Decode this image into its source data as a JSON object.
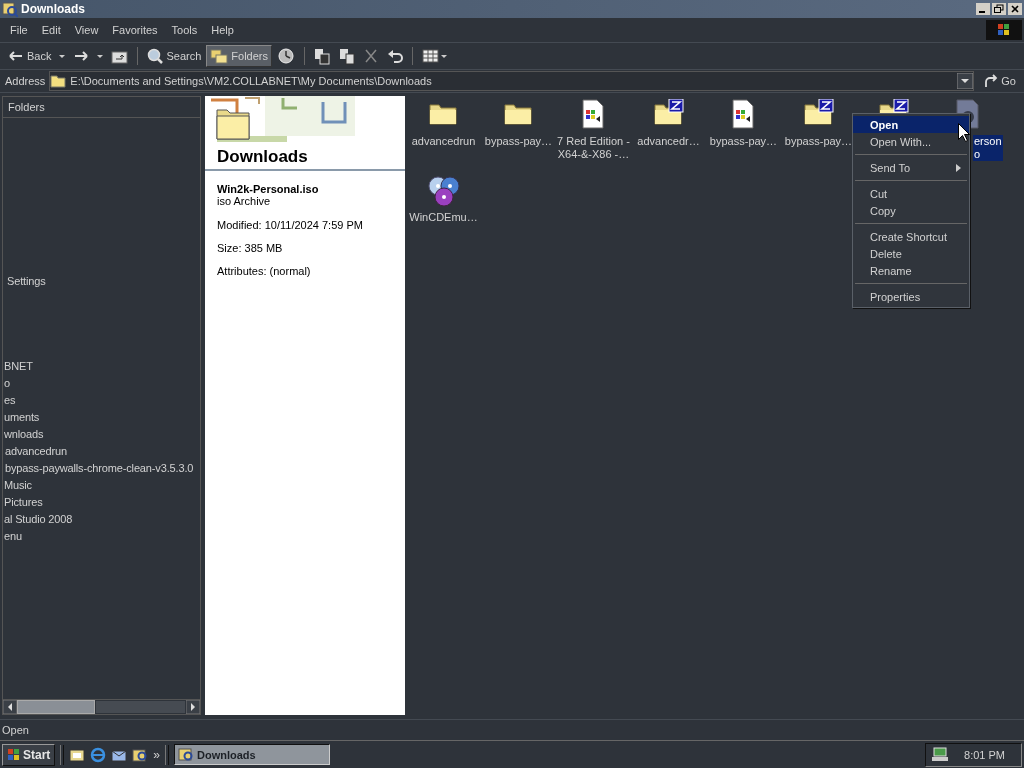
{
  "window": {
    "title": "Downloads"
  },
  "menu": [
    "File",
    "Edit",
    "View",
    "Favorites",
    "Tools",
    "Help"
  ],
  "toolbar": [
    {
      "kind": "back",
      "label": "Back",
      "pressed": false
    },
    {
      "kind": "caret",
      "pressed": false
    },
    {
      "kind": "forward",
      "pressed": false
    },
    {
      "kind": "caret",
      "pressed": false
    },
    {
      "kind": "up",
      "pressed": false
    },
    {
      "kind": "separator"
    },
    {
      "kind": "search",
      "label": "Search",
      "pressed": false
    },
    {
      "kind": "folders",
      "label": "Folders",
      "pressed": true
    },
    {
      "kind": "history",
      "pressed": false
    },
    {
      "kind": "separator"
    },
    {
      "kind": "move",
      "pressed": false
    },
    {
      "kind": "copy",
      "pressed": false
    },
    {
      "kind": "delete",
      "pressed": false
    },
    {
      "kind": "undo",
      "pressed": false
    },
    {
      "kind": "separator"
    },
    {
      "kind": "views",
      "pressed": false
    }
  ],
  "address": {
    "label": "Address",
    "value": "E:\\Documents and Settings\\VM2.COLLABNET\\My Documents\\Downloads",
    "go": "Go"
  },
  "folders_panel": {
    "title": "Folders",
    "tree": [
      {
        "label": "Settings",
        "children": [
          {
            "label": "BNET",
            "children": [
              {
                "label": "o"
              },
              {
                "label": "es"
              },
              {
                "label": "uments",
                "children": [
                  {
                    "label": "wnloads",
                    "children": [
                      {
                        "label": "advancedrun"
                      },
                      {
                        "label": "bypass-paywalls-chrome-clean-v3.5.3.0"
                      }
                    ]
                  },
                  {
                    "label": "Music"
                  },
                  {
                    "label": "Pictures"
                  },
                  {
                    "label": "al Studio 2008"
                  }
                ]
              },
              {
                "label": "enu"
              }
            ]
          }
        ]
      }
    ]
  },
  "web_view": {
    "title": "Downloads",
    "file_name": "Win2k-Personal.iso",
    "file_type": "iso Archive",
    "details": [
      "Modified: 10/11/2024 7:59 PM",
      "Size: 385 MB",
      "Attributes: (normal)"
    ]
  },
  "files": [
    {
      "kind": "folder",
      "name": "advancedrun",
      "selected": false
    },
    {
      "kind": "folder",
      "name": "bypass-pay…",
      "selected": false
    },
    {
      "kind": "setup",
      "name": "7 Red Edition -\nX64-&-X86 -…",
      "selected": false
    },
    {
      "kind": "zip",
      "name": "advancedr…",
      "selected": false
    },
    {
      "kind": "setup",
      "name": "bypass-pay…",
      "selected": false
    },
    {
      "kind": "zip",
      "name": "bypass-pay…",
      "selected": false
    },
    {
      "kind": "zip",
      "selected": false
    },
    {
      "kind": "iso",
      "name": "erson\no",
      "selected": true,
      "partly_hidden": true
    },
    {
      "kind": "disc",
      "name": "WinCDEmu…",
      "selected": false
    }
  ],
  "context_menu": [
    {
      "kind": "item",
      "label": "Open",
      "default": true,
      "selected": true
    },
    {
      "kind": "item",
      "label": "Open With...",
      "default": false,
      "selected": false
    },
    {
      "kind": "separator"
    },
    {
      "kind": "submenu",
      "label": "Send To",
      "default": false,
      "selected": false
    },
    {
      "kind": "separator"
    },
    {
      "kind": "item",
      "label": "Cut",
      "default": false,
      "selected": false
    },
    {
      "kind": "item",
      "label": "Copy",
      "default": false,
      "selected": false
    },
    {
      "kind": "separator"
    },
    {
      "kind": "item",
      "label": "Create Shortcut",
      "default": false,
      "selected": false
    },
    {
      "kind": "item",
      "label": "Delete",
      "default": false,
      "selected": false
    },
    {
      "kind": "item",
      "label": "Rename",
      "default": false,
      "selected": false
    },
    {
      "kind": "separator"
    },
    {
      "kind": "item",
      "label": "Properties",
      "default": false,
      "selected": false
    }
  ],
  "status_bar": "Open",
  "taskbar": {
    "start": "Start",
    "quick_launch": [
      {
        "kind": "desktop"
      },
      {
        "kind": "browser"
      },
      {
        "kind": "mail"
      },
      {
        "kind": "explorer"
      }
    ],
    "more": "»",
    "tasks": [
      {
        "label": "Downloads",
        "selected": true
      }
    ],
    "clock": "8:01 PM"
  }
}
